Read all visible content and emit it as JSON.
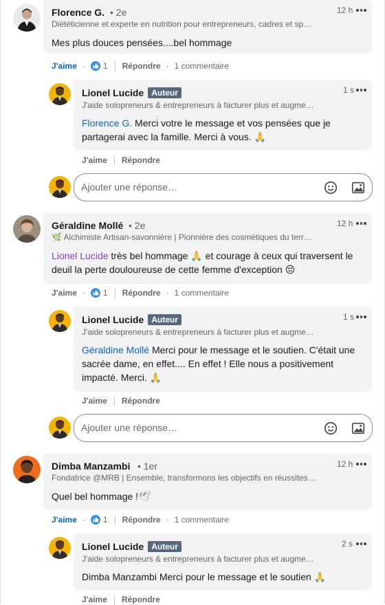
{
  "comments": [
    {
      "author": "Florence G.",
      "degree": "• 2e",
      "headline": "Diététicienne et experte en nutrition pour entrepreneurs, cadres et sp…",
      "time": "12 h",
      "text": "Mes plus douces pensées....bel hommage",
      "like_label": "J'aime",
      "like_count": "1",
      "reply_label": "Répondre",
      "comment_count": "1 commentaire",
      "reply": {
        "author": "Lionel Lucide",
        "badge": "Auteur",
        "headline": "J'aide solopreneurs & entrepreneurs à facturer plus et augme…",
        "time": "1 s",
        "mention": "Florence G.",
        "text": " Merci votre le message et vos pensées que je partagerai avec la famille. Merci à vous. ",
        "emoji": "🙏",
        "like_label": "J'aime",
        "reply_label": "Répondre"
      },
      "reply_box_placeholder": "Ajouter une réponse…"
    },
    {
      "author": "Géraldine Mollé",
      "degree": "• 2e",
      "headline": "🌿 Alchimiste Artisan-savonnière | Pionnière des cosmétiques du terr…",
      "time": "12 h",
      "mention": "Lionel Lucide",
      "text": " très bel hommage 🙏 et courage à ceux qui traversent le deuil la perte douloureuse de cette femme d'exception 😔",
      "like_label": "J'aime",
      "like_count": "1",
      "reply_label": "Répondre",
      "comment_count": "1 commentaire",
      "reply": {
        "author": "Lionel Lucide",
        "badge": "Auteur",
        "headline": "J'aide solopreneurs & entrepreneurs à facturer plus et augme…",
        "time": "1 s",
        "mention": "Géraldine Mollé",
        "text": " Merci pour le message et le soutien. C'était une sacrée dame, en effet.... En effet ! Elle nous a positivement impacté. Merci. ",
        "emoji": "🙏",
        "like_label": "J'aime",
        "reply_label": "Répondre"
      },
      "reply_box_placeholder": "Ajouter une réponse…"
    },
    {
      "author": "Dimba Manzambi",
      "degree": "• 1er",
      "headline": "Fondatrice @MRB | Ensemble, transformons les objectifs en réussites…",
      "time": "12 h",
      "text": "Quel bel hommage !",
      "emoji": "🕊",
      "like_label": "J'aime",
      "like_count": "1",
      "reply_label": "Répondre",
      "comment_count": "1 commentaire",
      "reply": {
        "author": "Lionel Lucide",
        "badge": "Auteur",
        "headline": "J'aide solopreneurs & entrepreneurs à facturer plus et augme…",
        "time": "2 s",
        "text": "Dimba Manzambi Merci pour le message et le soutien ",
        "emoji": "🙏",
        "like_label": "J'aime",
        "reply_label": "Répondre"
      }
    }
  ],
  "icons": {
    "more": "more-options-icon",
    "like": "thumbs-up-reaction-icon",
    "emoji": "emoji-smiley-icon",
    "image": "image-upload-icon"
  },
  "colors": {
    "accent": "#0a66c2",
    "mention_purple": "#8344cc",
    "bubble": "#f2f2f2",
    "author_badge": "#56687a"
  }
}
